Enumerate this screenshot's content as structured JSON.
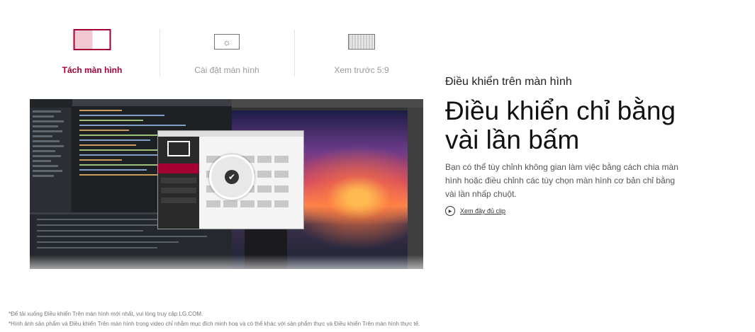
{
  "tabs": [
    {
      "label": "Tách màn hình",
      "icon": "split-screen-icon",
      "active": true
    },
    {
      "label": "Cài đặt màn hình",
      "icon": "screen-settings-icon",
      "active": false
    },
    {
      "label": "Xem trước 5:9",
      "icon": "preview-icon",
      "active": false
    }
  ],
  "content": {
    "eyebrow": "Điều khiển trên màn hình",
    "headline_line1": "Điều khiển chỉ bằng",
    "headline_line2": "vài lần bấm",
    "description": "Bạn có thể tùy chỉnh không gian làm việc bằng cách chia màn hình hoặc điều chỉnh các tùy chọn màn hình cơ bản chỉ bằng vài lần nhấp chuột.",
    "clip_link": "Xem đầy đủ clip"
  },
  "footnotes": {
    "note1": "*Để tải xuống Điều khiển Trên màn hình mới nhất, vui lòng truy cập LG.COM.",
    "note2": "*Hình ảnh sản phẩm và Điều khiển Trên màn hình trong video chỉ nhằm mục đích minh hoạ và có thể khác với sản phẩm thực và Điều khiển Trên màn hình thực tế."
  },
  "colors": {
    "accent": "#a50034",
    "text": "#111111",
    "muted": "#9a9a9a"
  }
}
